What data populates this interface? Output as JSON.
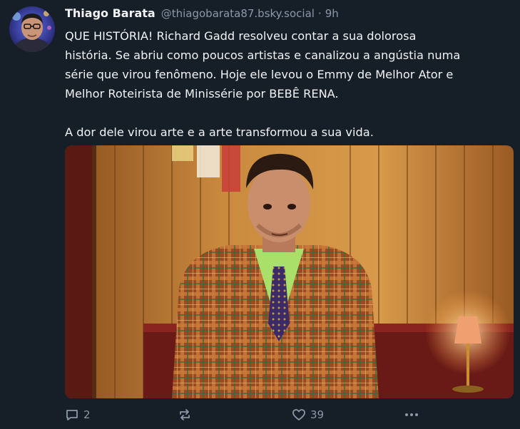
{
  "post": {
    "author": {
      "display_name": "Thiago Barata",
      "handle": "@thiagobarata87.bsky.social",
      "separator": "·",
      "time": "9h"
    },
    "text_lines": [
      "QUE HISTÓRIA! Richard Gadd resolveu contar a sua dolorosa",
      "história. Se abriu como poucos artistas e canalizou a angústia numa",
      "série que virou fenômeno. Hoje ele levou o Emmy de Melhor Ator e",
      "Melhor Roteirista de Minissérie por BEBÊ RENA."
    ],
    "text_line_2": "A dor dele virou arte e a arte transformou a sua vida.",
    "actions": {
      "reply_count": "2",
      "repost_count": "",
      "like_count": "39"
    },
    "icons": {
      "reply": "reply-icon",
      "repost": "repost-icon",
      "like": "heart-icon",
      "more": "more-options-icon"
    }
  },
  "colors": {
    "background": "#161e27",
    "text": "#f1f3f5",
    "muted": "#8b98a9"
  }
}
